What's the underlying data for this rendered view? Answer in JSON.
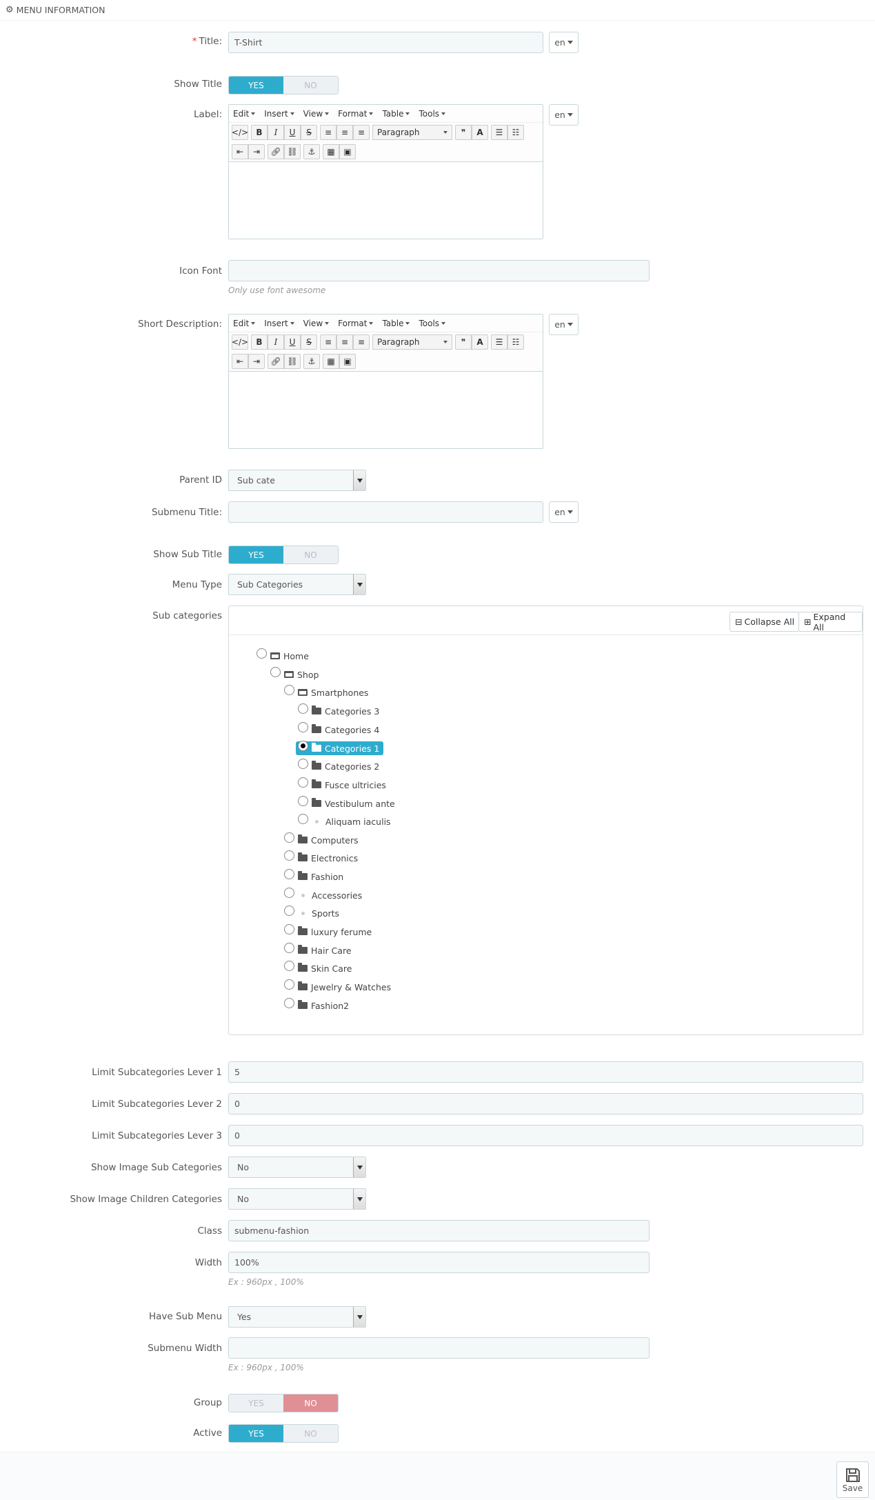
{
  "panel": {
    "title": "MENU INFORMATION"
  },
  "title": {
    "label": "Title:",
    "required": "*",
    "value": "T-Shirt",
    "lang": "en"
  },
  "show_title": {
    "label": "Show Title",
    "yes": "YES",
    "no": "NO",
    "value": "YES"
  },
  "label_field": {
    "label": "Label:",
    "lang": "en"
  },
  "editor": {
    "menus": [
      "Edit",
      "Insert",
      "View",
      "Format",
      "Table",
      "Tools"
    ],
    "format_value": "Paragraph"
  },
  "icon_font": {
    "label": "Icon Font",
    "value": "",
    "help": "Only use font awesome"
  },
  "short_description": {
    "label": "Short Description:",
    "lang": "en"
  },
  "parent_id": {
    "label": "Parent ID",
    "value": "Sub cate"
  },
  "submenu_title": {
    "label": "Submenu Title:",
    "value": "",
    "lang": "en"
  },
  "show_sub_title": {
    "label": "Show Sub Title",
    "yes": "YES",
    "no": "NO",
    "value": "YES"
  },
  "menu_type": {
    "label": "Menu Type",
    "value": "Sub Categories"
  },
  "sub_categories": {
    "label": "Sub categories",
    "collapse_all": "Collapse All",
    "expand_all": "Expand All",
    "tree": [
      {
        "label": "Home",
        "type": "open"
      },
      {
        "label": "Shop",
        "type": "open"
      },
      {
        "label": "Smartphones",
        "type": "open"
      },
      {
        "label": "Categories 3",
        "type": "folder"
      },
      {
        "label": "Categories 4",
        "type": "folder"
      },
      {
        "label": "Categories 1",
        "type": "folder",
        "selected": true
      },
      {
        "label": "Categories 2",
        "type": "folder"
      },
      {
        "label": "Fusce ultricies",
        "type": "folder"
      },
      {
        "label": "Vestibulum ante",
        "type": "folder"
      },
      {
        "label": "Aliquam iaculis",
        "type": "leaf"
      },
      {
        "label": "Computers",
        "type": "folder"
      },
      {
        "label": "Electronics",
        "type": "folder"
      },
      {
        "label": "Fashion",
        "type": "folder"
      },
      {
        "label": "Accessories",
        "type": "leaf"
      },
      {
        "label": "Sports",
        "type": "leaf"
      },
      {
        "label": "luxury ferume",
        "type": "folder"
      },
      {
        "label": "Hair Care",
        "type": "folder"
      },
      {
        "label": "Skin Care",
        "type": "folder"
      },
      {
        "label": "Jewelry & Watches",
        "type": "folder"
      },
      {
        "label": "Fashion2",
        "type": "folder"
      }
    ]
  },
  "limit1": {
    "label": "Limit Subcategories Lever 1",
    "value": "5"
  },
  "limit2": {
    "label": "Limit Subcategories Lever 2",
    "value": "0"
  },
  "limit3": {
    "label": "Limit Subcategories Lever 3",
    "value": "0"
  },
  "show_image_sub": {
    "label": "Show Image Sub Categories",
    "value": "No"
  },
  "show_image_children": {
    "label": "Show Image Children Categories",
    "value": "No"
  },
  "class_field": {
    "label": "Class",
    "value": "submenu-fashion"
  },
  "width_field": {
    "label": "Width",
    "value": "100%",
    "help": "Ex : 960px , 100%"
  },
  "have_sub_menu": {
    "label": "Have Sub Menu",
    "value": "Yes"
  },
  "submenu_width": {
    "label": "Submenu Width",
    "value": "",
    "help": "Ex : 960px , 100%"
  },
  "group": {
    "label": "Group",
    "yes": "YES",
    "no": "NO",
    "value": "NO"
  },
  "active": {
    "label": "Active",
    "yes": "YES",
    "no": "NO",
    "value": "YES"
  },
  "save": {
    "label": "Save"
  },
  "colors": {
    "accent": "#2eacce",
    "danger": "#e08f95",
    "required": "#e2343e"
  }
}
